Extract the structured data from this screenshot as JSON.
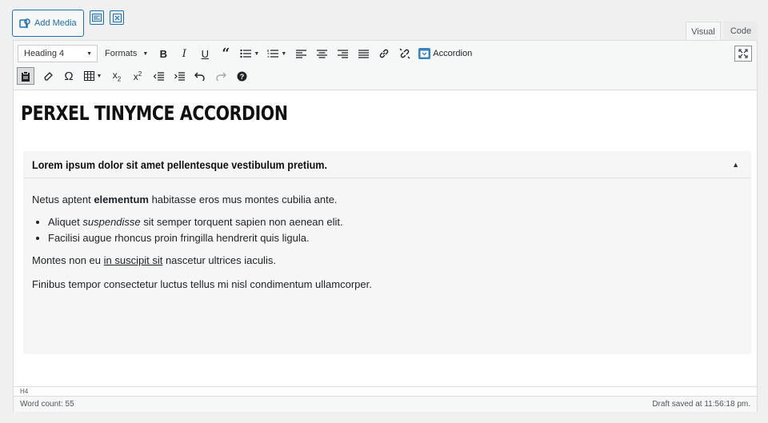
{
  "media": {
    "add_media_label": "Add Media"
  },
  "tabs": {
    "visual": "Visual",
    "code": "Code"
  },
  "toolbar": {
    "block_format": "Heading 4",
    "formats_label": "Formats",
    "accordion_label": "Accordion"
  },
  "content": {
    "heading": "PERXEL TINYMCE ACCORDION",
    "accordion": {
      "title": "Lorem ipsum dolor sit amet pellentesque vestibulum pretium.",
      "toggle": "▲",
      "p1": {
        "before": "Netus aptent ",
        "bold": "elementum",
        "after": " habitasse eros mus montes cubilia ante."
      },
      "list": [
        {
          "before": "Aliquet ",
          "italic": "suspendisse",
          "after": " sit semper torquent sapien non aenean elit."
        },
        {
          "text": "Facilisi augue rhoncus proin fringilla hendrerit quis ligula."
        }
      ],
      "p2": {
        "before": "Montes non eu ",
        "underline": "in suscipit sit",
        "after": " nascetur ultrices iaculis."
      },
      "p3": "Finibus tempor consectetur luctus tellus mi nisl condimentum ullamcorper."
    }
  },
  "status": {
    "path": "H4",
    "word_count": "Word count: 55",
    "draft_saved": "Draft saved at 11:56:18 pm."
  },
  "colors": {
    "accent": "#2271b1",
    "accordion_icon": "#3582c4",
    "accordion_bg": "#f6f6f6"
  }
}
